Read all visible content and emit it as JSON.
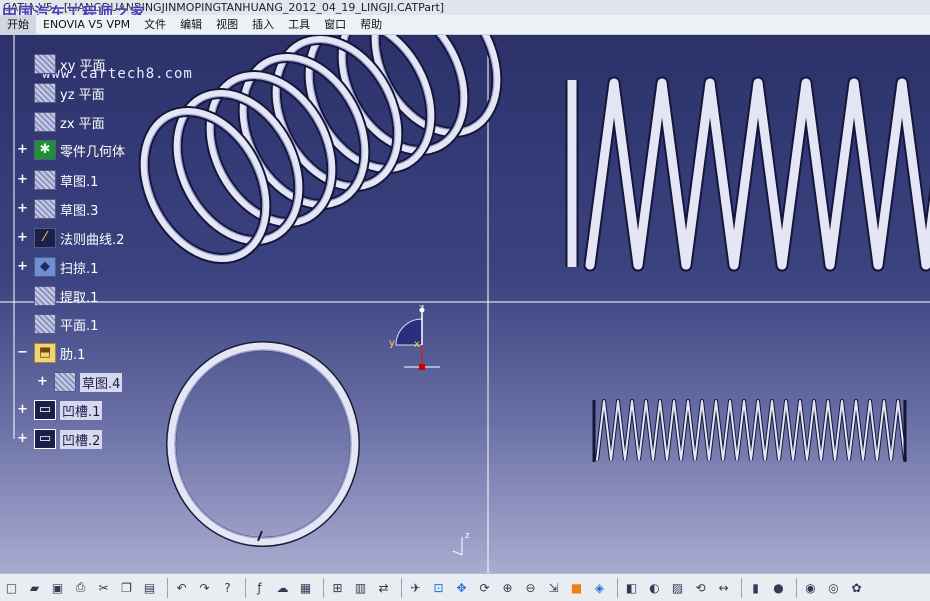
{
  "window": {
    "title": "CATIA V5 - [LIANGDUANBINGJINMOPINGTANHUANG_2012_04_19_LINGJI.CATPart]",
    "watermark_text": "中国汽车工程师之家",
    "watermark_url": "www.cartech8.com"
  },
  "menu": {
    "items": [
      "开始",
      "ENOVIA V5 VPM",
      "文件",
      "编辑",
      "视图",
      "插入",
      "工具",
      "窗口",
      "帮助"
    ]
  },
  "tree": {
    "items": [
      {
        "label": "xy 平面",
        "icon": "plane-icon",
        "expander": ""
      },
      {
        "label": "yz 平面",
        "icon": "plane-icon",
        "expander": ""
      },
      {
        "label": "zx 平面",
        "icon": "plane-icon",
        "expander": ""
      },
      {
        "label": "零件几何体",
        "icon": "part-body-icon",
        "expander": "+"
      },
      {
        "label": "草图.1",
        "icon": "sketch-icon",
        "expander": "+"
      },
      {
        "label": "草图.3",
        "icon": "sketch-icon",
        "expander": "+"
      },
      {
        "label": "法则曲线.2",
        "icon": "law-curve-icon",
        "expander": "+"
      },
      {
        "label": "扫掠.1",
        "icon": "sweep-icon",
        "expander": "+"
      },
      {
        "label": "提取.1",
        "icon": "extract-icon",
        "expander": ""
      },
      {
        "label": "平面.1",
        "icon": "plane-icon",
        "expander": ""
      },
      {
        "label": "肋.1",
        "icon": "rib-icon",
        "expander": "−"
      },
      {
        "label": "草图.4",
        "icon": "sketch-icon",
        "expander": "+"
      },
      {
        "label": "凹槽.1",
        "icon": "pocket-icon",
        "expander": "+"
      },
      {
        "label": "凹槽.2",
        "icon": "pocket-icon",
        "expander": "+"
      }
    ]
  },
  "compass": {
    "axis_z": "z",
    "axis_y": "y",
    "axis_x": "x"
  },
  "axis_triad": {
    "axis_z": "z"
  },
  "colors": {
    "background_top": "#2c316a",
    "background_bottom": "#a9acd0",
    "spring": "#e4e6f6",
    "tree_text": "#ffffff"
  },
  "toolbar": {
    "icons": [
      "new-icon",
      "open-icon",
      "save-icon",
      "print-icon",
      "cut-icon",
      "copy-icon",
      "paste-icon",
      "undo-icon",
      "redo-icon",
      "whats-this-icon",
      "formula-icon",
      "knowledge-icon",
      "table-icon",
      "tree-icon",
      "catalog-icon",
      "plane-align-icon",
      "fly-mode-icon",
      "fit-all-icon",
      "pan-icon",
      "rotate-icon",
      "zoom-in-icon",
      "zoom-out-icon",
      "normal-view-icon",
      "render-style-icon",
      "isometric-icon",
      "shading-icon",
      "hide-show-icon",
      "swap-space-icon",
      "update-icon",
      "measure-icon",
      "analyze-icon",
      "material-icon",
      "capture-icon",
      "global-icon",
      "help-icon"
    ]
  }
}
